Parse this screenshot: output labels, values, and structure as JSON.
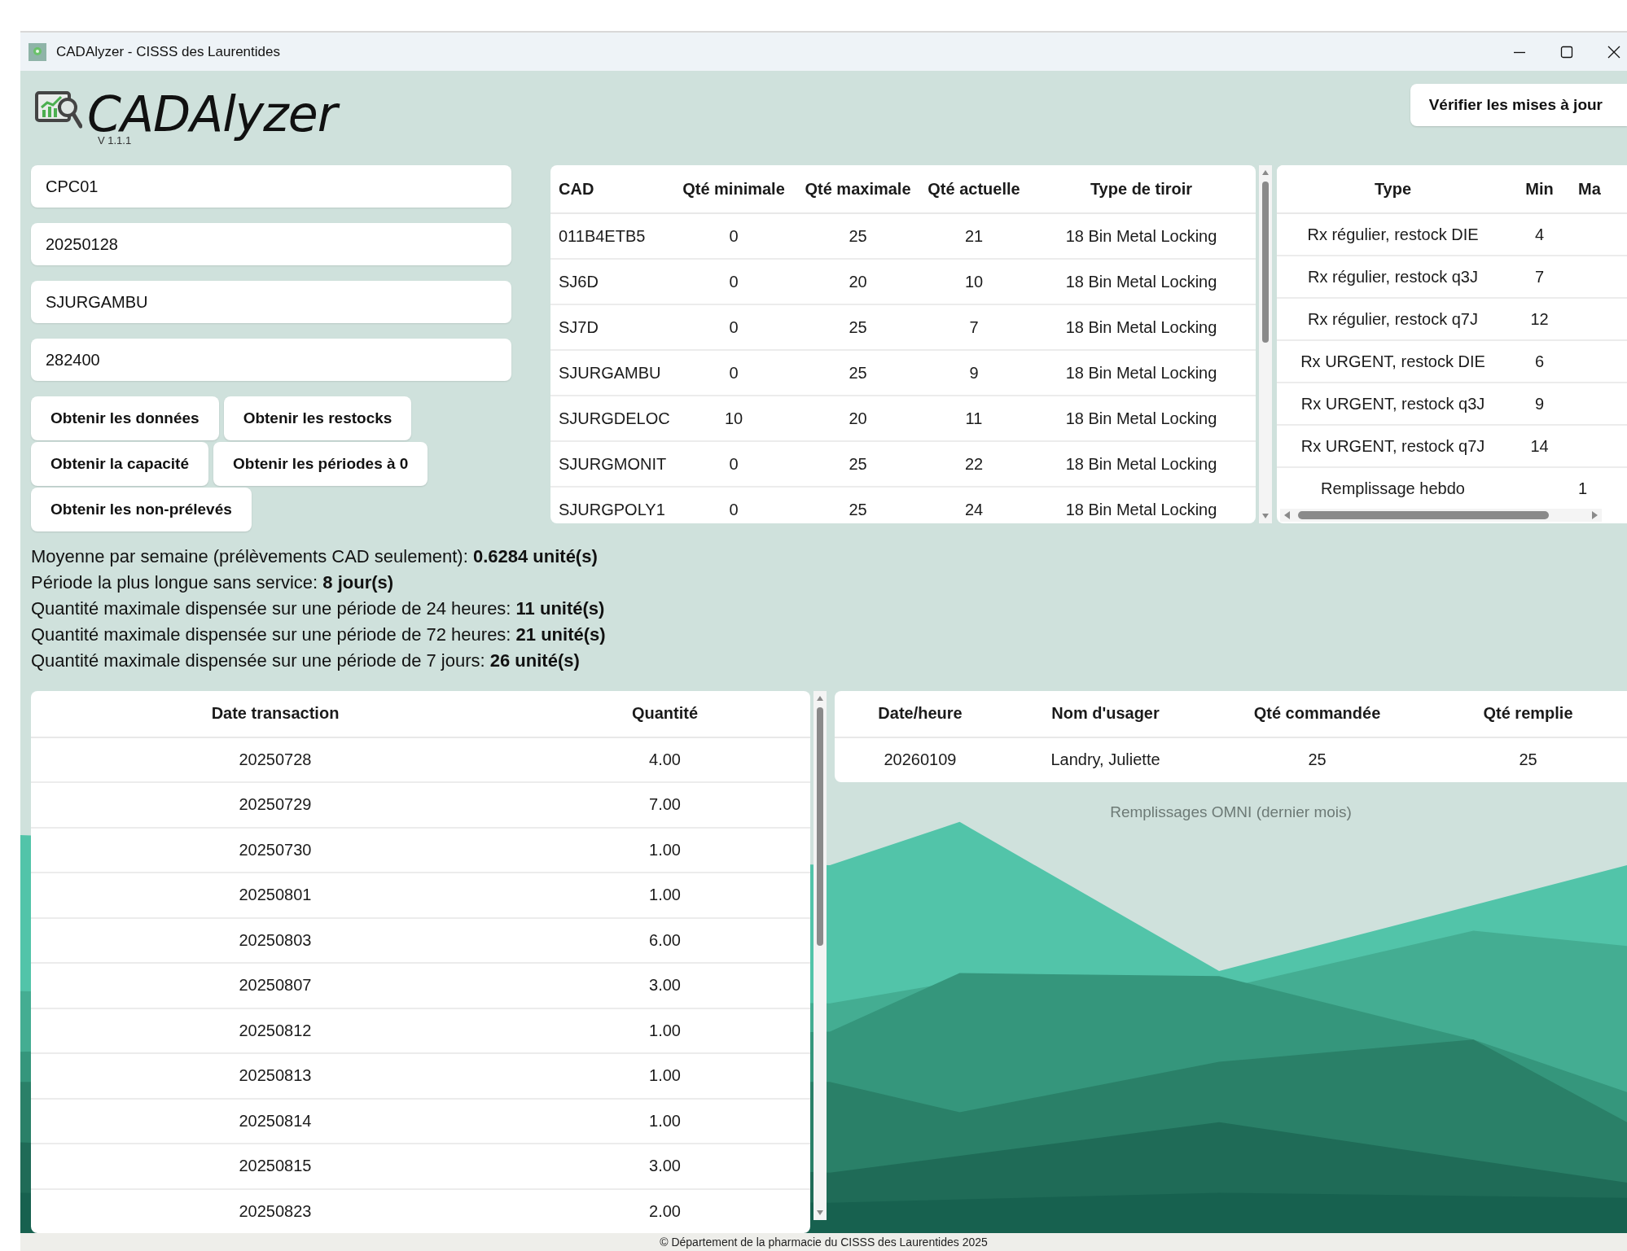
{
  "window": {
    "title": "CADAlyzer - CISSS des Laurentides"
  },
  "header": {
    "app_name": "CADAlyzer",
    "version": "V 1.1.1",
    "update_button": "Vérifier les mises à jour"
  },
  "fields": [
    {
      "value": "CPC01"
    },
    {
      "value": "20250128"
    },
    {
      "value": "SJURGAMBU"
    },
    {
      "value": "282400"
    }
  ],
  "action_buttons": [
    [
      "Obtenir les données",
      "Obtenir les restocks"
    ],
    [
      "Obtenir la capacité",
      "Obtenir les périodes à 0"
    ],
    [
      "Obtenir les non-prélevés"
    ]
  ],
  "cad_table": {
    "columns": [
      "CAD",
      "Qté minimale",
      "Qté maximale",
      "Qté actuelle",
      "Type de tiroir"
    ],
    "rows": [
      [
        "011B4ETB5",
        "0",
        "25",
        "21",
        "18 Bin Metal Locking"
      ],
      [
        "SJ6D",
        "0",
        "20",
        "10",
        "18 Bin Metal Locking"
      ],
      [
        "SJ7D",
        "0",
        "25",
        "7",
        "18 Bin Metal Locking"
      ],
      [
        "SJURGAMBU",
        "0",
        "25",
        "9",
        "18 Bin Metal Locking"
      ],
      [
        "SJURGDELOC",
        "10",
        "20",
        "11",
        "18 Bin Metal Locking"
      ],
      [
        "SJURGMONIT",
        "0",
        "25",
        "22",
        "18 Bin Metal Locking"
      ],
      [
        "SJURGPOLY1",
        "0",
        "25",
        "24",
        "18 Bin Metal Locking"
      ]
    ]
  },
  "type_table": {
    "columns": [
      "Type",
      "Min",
      "Ma"
    ],
    "rows": [
      [
        "Rx régulier, restock DIE",
        "4",
        ""
      ],
      [
        "Rx régulier, restock q3J",
        "7",
        ""
      ],
      [
        "Rx régulier, restock q7J",
        "12",
        ""
      ],
      [
        "Rx URGENT, restock DIE",
        "6",
        ""
      ],
      [
        "Rx URGENT, restock q3J",
        "9",
        ""
      ],
      [
        "Rx URGENT, restock q7J",
        "14",
        ""
      ],
      [
        "Remplissage hebdo",
        "",
        "1"
      ]
    ]
  },
  "stats": [
    "Moyenne par semaine (prélèvements CAD seulement): **0.6284 unité(s)**",
    "Période la plus longue sans service: **8 jour(s)**",
    "Quantité maximale dispensée sur une période de 24 heures: **11 unité(s)**",
    "Quantité maximale dispensée sur une période de 72 heures: **21 unité(s)**",
    "Quantité maximale dispensée sur une période de 7 jours: **26 unité(s)**"
  ],
  "transactions_table": {
    "columns": [
      "Date transaction",
      "Quantité"
    ],
    "rows": [
      [
        "20250728",
        "4.00"
      ],
      [
        "20250729",
        "7.00"
      ],
      [
        "20250730",
        "1.00"
      ],
      [
        "20250801",
        "1.00"
      ],
      [
        "20250803",
        "6.00"
      ],
      [
        "20250807",
        "3.00"
      ],
      [
        "20250812",
        "1.00"
      ],
      [
        "20250813",
        "1.00"
      ],
      [
        "20250814",
        "1.00"
      ],
      [
        "20250815",
        "3.00"
      ],
      [
        "20250823",
        "2.00"
      ]
    ]
  },
  "omni_table": {
    "columns": [
      "Date/heure",
      "Nom d'usager",
      "Qté commandée",
      "Qté remplie"
    ],
    "rows": [
      [
        "20260109",
        "Landry, Juliette",
        "25",
        "25"
      ]
    ]
  },
  "omni_caption": "Remplissages OMNI (dernier mois)",
  "footer": "© Département de la pharmacie du CISSS des Laurentides 2025"
}
